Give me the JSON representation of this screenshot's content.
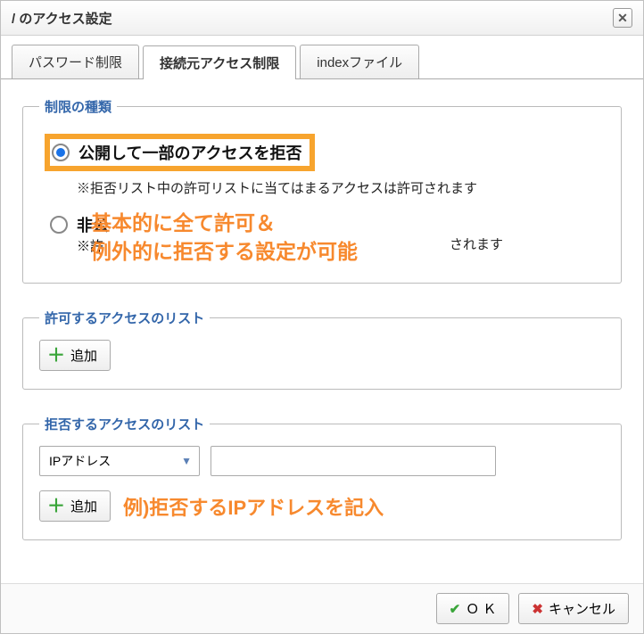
{
  "dialog": {
    "title": "/ のアクセス設定"
  },
  "tabs": {
    "password": "パスワード制限",
    "access": "接続元アクセス制限",
    "index": "indexファイル"
  },
  "restriction": {
    "legend": "制限の種類",
    "opt1_label": "公開して一部のアクセスを拒否",
    "opt1_note": "※拒否リスト中の許可リストに当てはまるアクセスは許可されます",
    "opt2_label_prefix": "非公",
    "opt2_note_prefix": "※許",
    "opt2_note_suffix": "されます",
    "annotation_line1": "基本的に全て許可＆",
    "annotation_line2": "例外的に拒否する設定が可能"
  },
  "allow": {
    "legend": "許可するアクセスのリスト",
    "add": "追加"
  },
  "deny": {
    "legend": "拒否するアクセスのリスト",
    "type_selected": "IPアドレス",
    "add": "追加",
    "annotation": "例)拒否するIPアドレスを記入"
  },
  "footer": {
    "ok": "Ｏ Ｋ",
    "cancel": "キャンセル"
  }
}
